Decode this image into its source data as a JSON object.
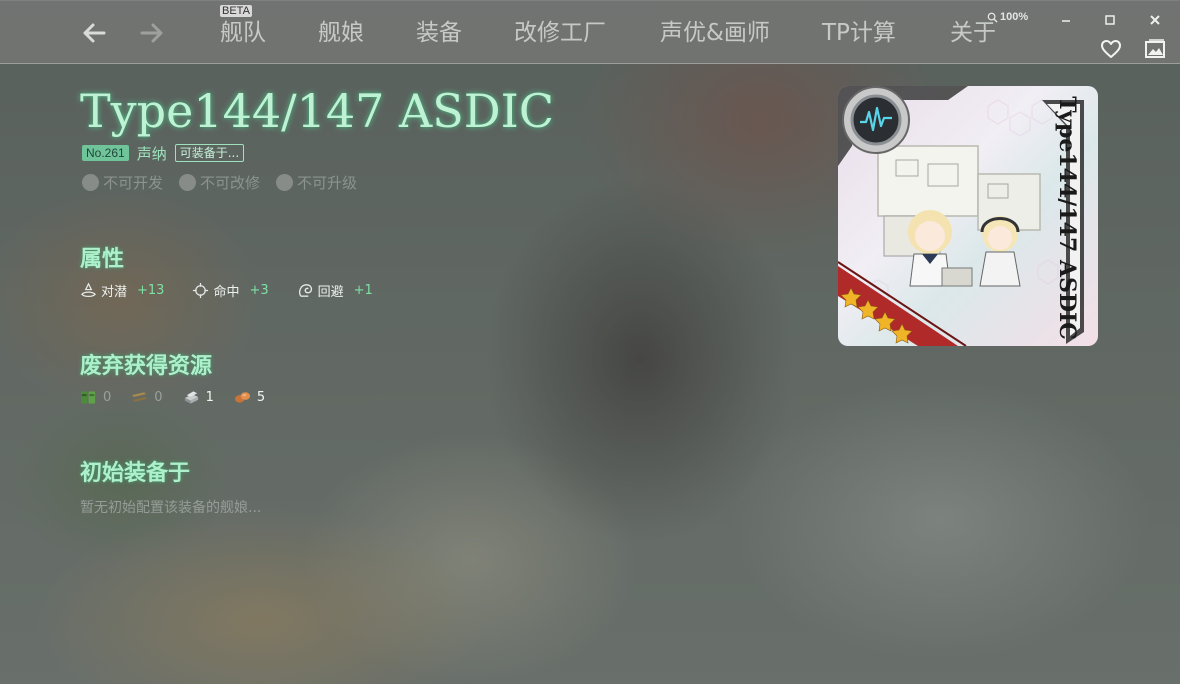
{
  "nav": {
    "beta_label": "BETA",
    "items": [
      "舰队",
      "舰娘",
      "装备",
      "改修工厂",
      "声优&画师",
      "TP计算",
      "关于"
    ],
    "zoom": "100%"
  },
  "equipment": {
    "name": "Type144/147 ASDIC",
    "number": "No.261",
    "type": "声纳",
    "equip_on_label": "可装备于...",
    "flags": [
      "不可开发",
      "不可改修",
      "不可升级"
    ],
    "card_text": "Type144/147 ASDIC"
  },
  "sections": {
    "stats_title": "属性",
    "scrap_title": "废弃获得资源",
    "initial_title": "初始装备于",
    "initial_empty": "暂无初始配置该装备的舰娘..."
  },
  "stats": [
    {
      "icon": "anti-submarine-icon",
      "label": "对潜",
      "value": "+13"
    },
    {
      "icon": "accuracy-icon",
      "label": "命中",
      "value": "+3"
    },
    {
      "icon": "evasion-icon",
      "label": "回避",
      "value": "+1"
    }
  ],
  "resources": [
    {
      "icon": "fuel-icon",
      "value": "0"
    },
    {
      "icon": "ammo-icon",
      "value": "0"
    },
    {
      "icon": "steel-icon",
      "value": "1"
    },
    {
      "icon": "bauxite-icon",
      "value": "5"
    }
  ],
  "colors": {
    "accent": "#9ee2bd",
    "title_glow": "#5ad296",
    "stat_value": "#7ee0a4",
    "card_stripe": "#b02a2a",
    "star": "#f0b429"
  }
}
